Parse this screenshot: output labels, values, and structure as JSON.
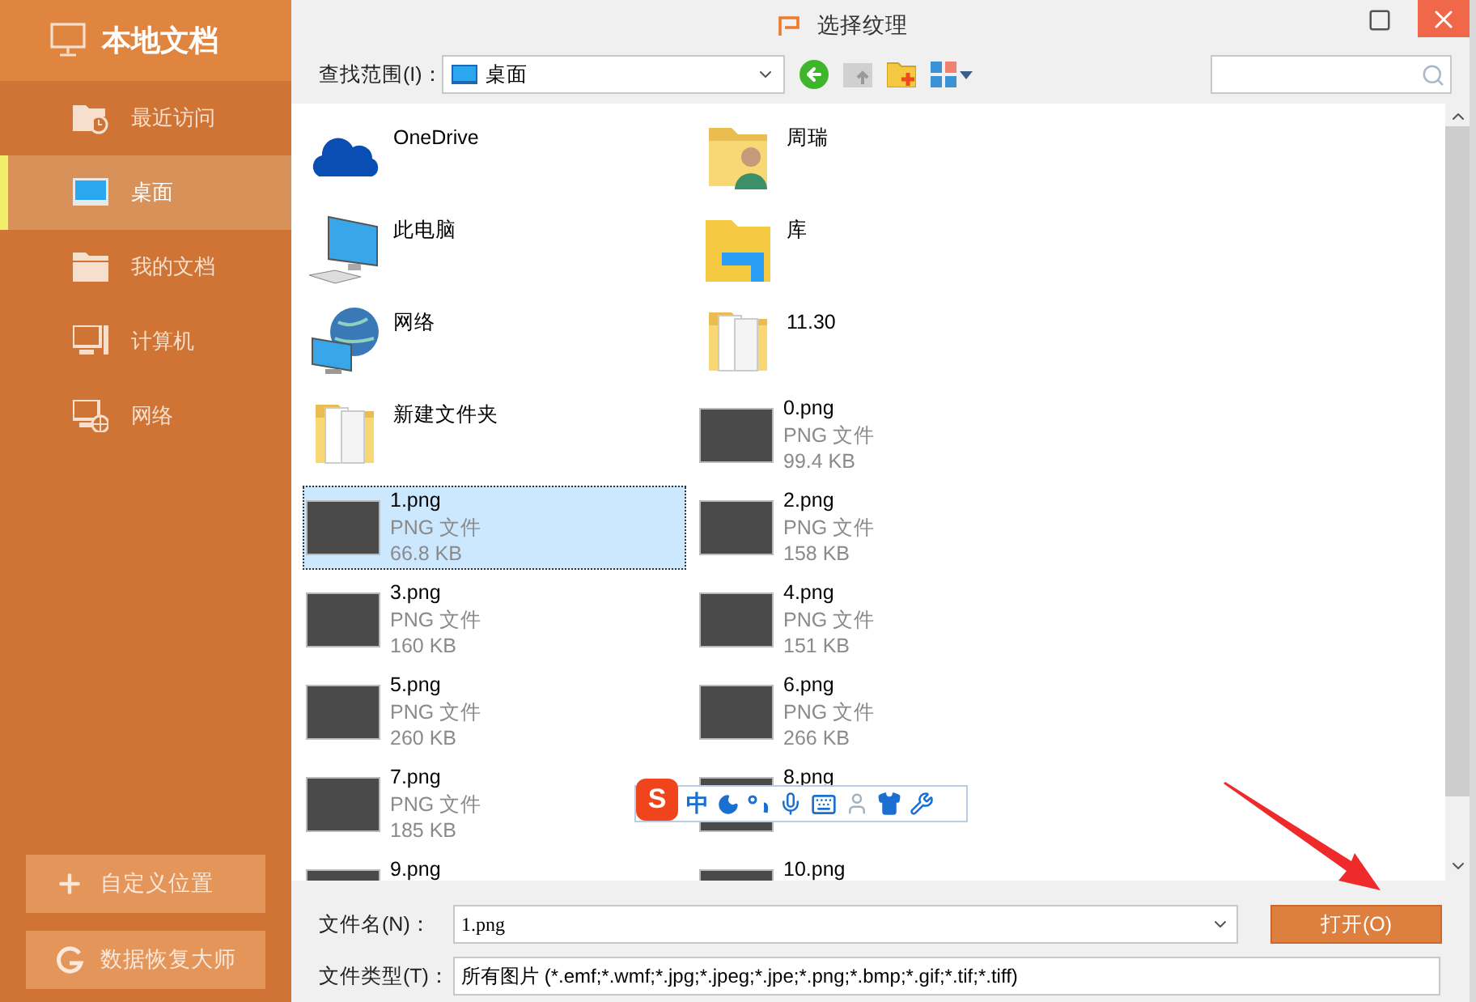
{
  "sidebar": {
    "title": "本地文档",
    "items": [
      {
        "kind": "recent",
        "label": "最近访问",
        "selected": false
      },
      {
        "kind": "desktop",
        "label": "桌面",
        "selected": true
      },
      {
        "kind": "documents",
        "label": "我的文档",
        "selected": false
      },
      {
        "kind": "computer",
        "label": "计算机",
        "selected": false
      },
      {
        "kind": "network",
        "label": "网络",
        "selected": false
      }
    ],
    "buttons": [
      {
        "kind": "plus",
        "label": "自定义位置"
      },
      {
        "kind": "recovery",
        "label": "数据恢复大师"
      }
    ]
  },
  "dialog": {
    "title": "选择纹理",
    "look_in": {
      "label": "查找范围(I)：",
      "value": "桌面"
    },
    "files": [
      {
        "kind": "onedrive",
        "name": "OneDrive",
        "selected": false
      },
      {
        "kind": "user_folder",
        "name": "周瑞",
        "selected": false
      },
      {
        "kind": "computer",
        "name": "此电脑",
        "selected": false
      },
      {
        "kind": "library",
        "name": "库",
        "selected": false
      },
      {
        "kind": "network",
        "name": "网络",
        "selected": false
      },
      {
        "kind": "doc_folder",
        "name": "11.30",
        "selected": false
      },
      {
        "kind": "doc_folder",
        "name": "新建文件夹",
        "selected": false
      },
      {
        "kind": "image",
        "name": "0.png",
        "type": "PNG 文件",
        "size": "99.4 KB",
        "selected": false
      },
      {
        "kind": "image",
        "name": "1.png",
        "type": "PNG 文件",
        "size": "66.8 KB",
        "selected": true
      },
      {
        "kind": "image",
        "name": "2.png",
        "type": "PNG 文件",
        "size": "158 KB",
        "selected": false
      },
      {
        "kind": "image",
        "name": "3.png",
        "type": "PNG 文件",
        "size": "160 KB",
        "selected": false
      },
      {
        "kind": "image",
        "name": "4.png",
        "type": "PNG 文件",
        "size": "151 KB",
        "selected": false
      },
      {
        "kind": "image",
        "name": "5.png",
        "type": "PNG 文件",
        "size": "260 KB",
        "selected": false
      },
      {
        "kind": "image",
        "name": "6.png",
        "type": "PNG 文件",
        "size": "266 KB",
        "selected": false
      },
      {
        "kind": "image",
        "name": "7.png",
        "type": "PNG 文件",
        "size": "185 KB",
        "selected": false
      },
      {
        "kind": "image",
        "name": "8.png",
        "selected": false
      },
      {
        "kind": "image",
        "name": "9.png",
        "selected": false
      },
      {
        "kind": "image",
        "name": "10.png",
        "selected": false
      }
    ],
    "filename": {
      "label": "文件名(N)：",
      "value": "1.png"
    },
    "filetype": {
      "label": "文件类型(T)：",
      "value": "所有图片 (*.emf;*.wmf;*.jpg;*.jpeg;*.jpe;*.png;*.bmp;*.gif;*.tif;*.tiff)"
    },
    "open_button": "打开(O)"
  },
  "ime_toolbar": {
    "logo": "S",
    "mode": "中"
  }
}
